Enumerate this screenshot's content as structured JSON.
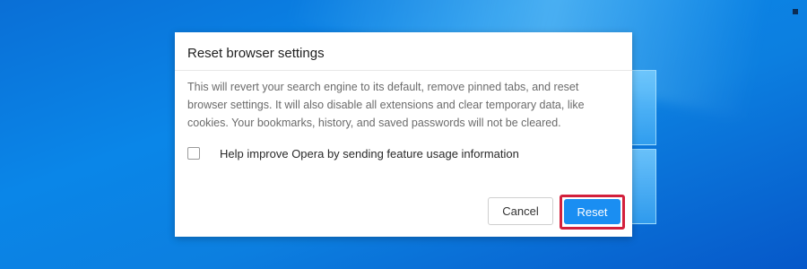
{
  "dialog": {
    "title": "Reset browser settings",
    "description": "This will revert your search engine to its default, remove pinned tabs, and reset browser settings. It will also disable all extensions and clear temporary data, like cookies. Your bookmarks, history, and saved passwords will not be cleared.",
    "checkbox": {
      "label": "Help improve Opera by sending feature usage information",
      "checked": false
    },
    "buttons": {
      "cancel_label": "Cancel",
      "reset_label": "Reset"
    }
  },
  "colors": {
    "desktop_background": "#0a7fe0",
    "reset_button": "#1a8ef2",
    "highlight_border": "#d3203c"
  }
}
